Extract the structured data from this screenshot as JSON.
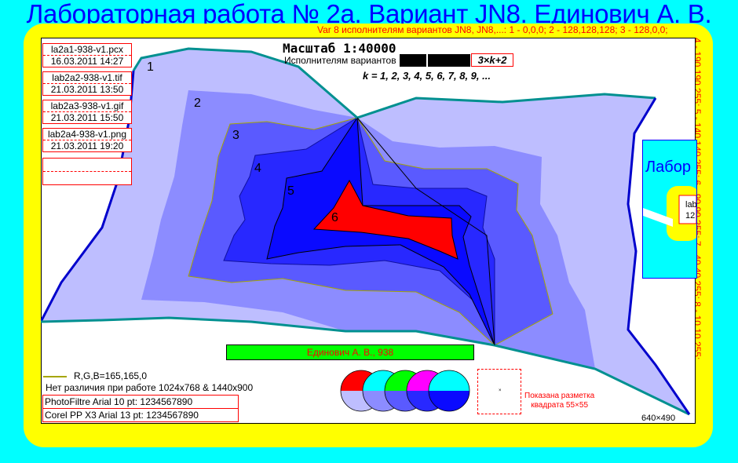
{
  "title": "Лабораторная работа № 2а. Вариант JN8. Единович А. В.",
  "var_top": "Var 8 исполнителям вариантов JN8, JN8,...: 1 - 0,0,0; 2 - 128,128,128; 3 - 128,0,0;",
  "var_side": "4 - 190,190,255; 5 - 140,140,255; 6 - 90,90,255; 7 - 40,40,255; 8 - 10,10,255;",
  "files": [
    {
      "name": "la2a1-938-v1.pcx",
      "date": "16.03.2011 14:27"
    },
    {
      "name": "lab2a2-938-v1.tif",
      "date": "21.03.2011 13:50"
    },
    {
      "name": "lab2a3-938-v1.gif",
      "date": "21.03.2011 15:50"
    },
    {
      "name": "lab2a4-938-v1.png",
      "date": "21.03.2011 19:20"
    }
  ],
  "scale_label": "Масштаб 1:40000",
  "executors_label": "Исполнителям вариантов",
  "formula": "3×k+2",
  "k_line": "k = 1, 2, 3, 4, 5, 6, 7, 8, 9, ...",
  "region_labels": [
    "1",
    "2",
    "3",
    "4",
    "5",
    "6"
  ],
  "author_bar": "Единович А. В., 938",
  "legend_rgb": "R,G,B=165,165,0",
  "no_diff": "Нет различия при работе 1024x768 & 1440x900",
  "font_lines": [
    "PhotoFiltre  Arial  10 pt:    1234567890",
    "Corel PP X3  Arial 13 pt:    1234567890"
  ],
  "grid_note": "Показана разметка\nквадрата 55×55",
  "grid_marker": "×",
  "dims": "640×490",
  "thumb": {
    "title": "Лабор",
    "line1": "lab",
    "line2": "12"
  },
  "colors": {
    "background": "#00ffff",
    "frame": "#ffff00",
    "title": "#0000ff",
    "region_1": "#bebeff",
    "region_2": "#8c8cff",
    "region_3": "#5a5aff",
    "region_4": "#2828ff",
    "region_5": "#0a0aff",
    "region_6": "#ff0000",
    "legend_line": "#a5a500",
    "author_bar": "#00ff00"
  }
}
